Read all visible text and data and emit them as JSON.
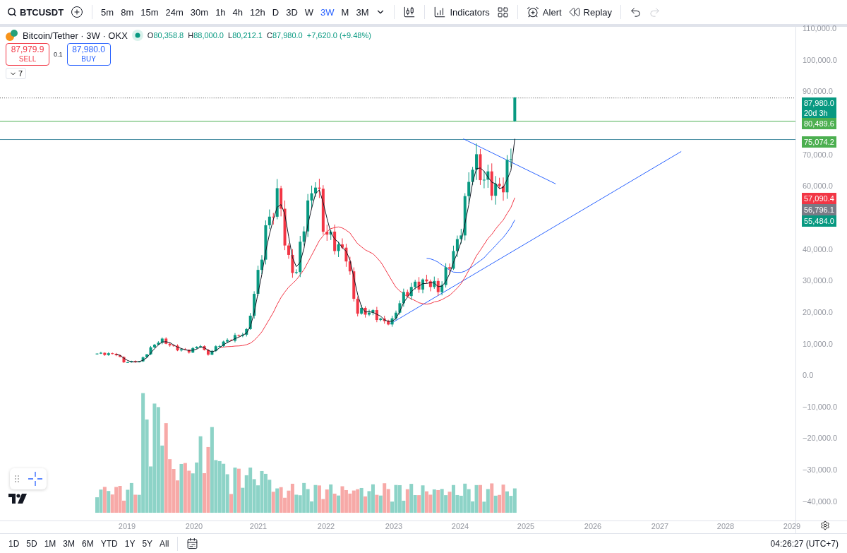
{
  "toolbar": {
    "symbol": "BTCUSDT",
    "intervals": [
      {
        "label": "5m",
        "selected": false
      },
      {
        "label": "8m",
        "selected": false
      },
      {
        "label": "15m",
        "selected": false
      },
      {
        "label": "24m",
        "selected": false
      },
      {
        "label": "30m",
        "selected": false
      },
      {
        "label": "1h",
        "selected": false
      },
      {
        "label": "4h",
        "selected": false
      },
      {
        "label": "12h",
        "selected": false
      },
      {
        "label": "D",
        "selected": false
      },
      {
        "label": "3D",
        "selected": false
      },
      {
        "label": "W",
        "selected": false
      },
      {
        "label": "3W",
        "selected": true
      },
      {
        "label": "M",
        "selected": false
      },
      {
        "label": "3M",
        "selected": false
      }
    ],
    "indicators_label": "Indicators",
    "alert_label": "Alert",
    "replay_label": "Replay",
    "undo": {
      "disabled": false
    },
    "redo": {
      "disabled": true
    }
  },
  "legend": {
    "title": "Bitcoin/Tether · 3W · OKX",
    "ohlc": [
      {
        "label": "O",
        "value": "80,358.8"
      },
      {
        "label": "H",
        "value": "88,000.0"
      },
      {
        "label": "L",
        "value": "80,212.1"
      },
      {
        "label": "C",
        "value": "87,980.0"
      }
    ],
    "change": "+7,620.0 (+9.48%)",
    "sell": {
      "price": "87,979.9",
      "label": "SELL"
    },
    "spread": "0.1",
    "buy": {
      "price": "87,980.0",
      "label": "BUY"
    },
    "indicator_count": "7"
  },
  "price_axis": {
    "ticks": [
      "110,000.0",
      "100,000.0",
      "90,000.0",
      "70,000.0",
      "60,000.0",
      "40,000.0",
      "30,000.0",
      "20,000.0",
      "10,000.0",
      "0.0",
      "−10,000.0",
      "−20,000.0",
      "−30,000.0",
      "−40,000.0"
    ],
    "tags": [
      {
        "text": "87,980.0",
        "sub": "20d 3h",
        "color": "#089981"
      },
      {
        "text": "80,489.6",
        "color": "#4caf50"
      },
      {
        "text": "75,074.2",
        "color": "#4caf50"
      },
      {
        "text": "57,090.4",
        "color": "#f23645"
      },
      {
        "text": "56,796.1",
        "color": "#787b86"
      },
      {
        "text": "55,484.0",
        "color": "#089981"
      }
    ]
  },
  "time_axis": [
    "2019",
    "2020",
    "2021",
    "2022",
    "2023",
    "2024",
    "2025",
    "2026",
    "2027",
    "2028",
    "2029"
  ],
  "ranges": [
    "1D",
    "5D",
    "1M",
    "3M",
    "6M",
    "YTD",
    "1Y",
    "5Y",
    "All"
  ],
  "clock": "04:26:27 (UTC+7)"
}
